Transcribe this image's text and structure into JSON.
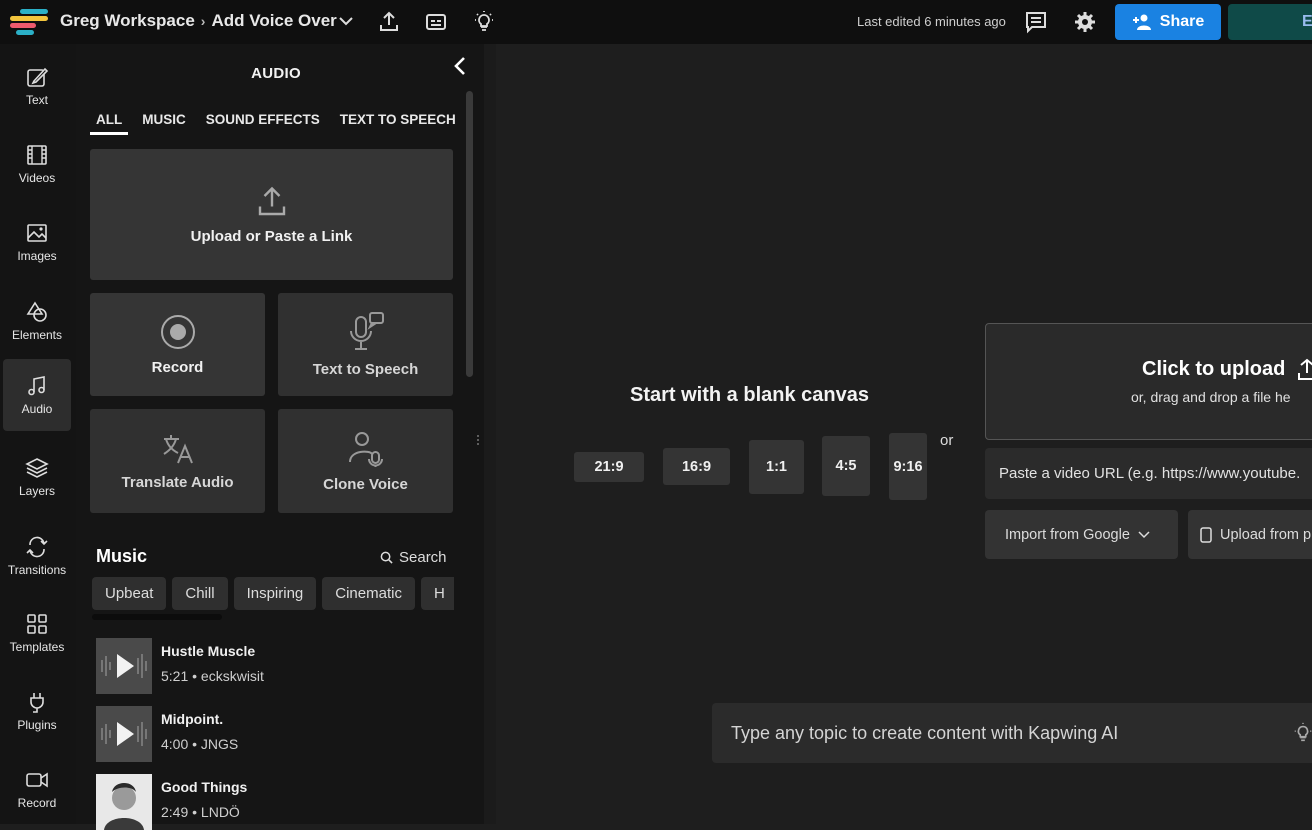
{
  "header": {
    "workspace": "Greg Workspace",
    "separator": "›",
    "project": "Add Voice Over",
    "last_edited": "Last edited 6 minutes ago",
    "share_label": "Share",
    "export_label": "E",
    "icons": [
      "upload-icon",
      "subtitles-icon",
      "lightbulb-icon",
      "comment-icon",
      "gear-icon"
    ]
  },
  "nav": {
    "items": [
      {
        "label": "Text",
        "icon": "text-icon"
      },
      {
        "label": "Videos",
        "icon": "film-icon"
      },
      {
        "label": "Images",
        "icon": "image-icon"
      },
      {
        "label": "Elements",
        "icon": "shapes-icon"
      },
      {
        "label": "Audio",
        "icon": "music-note-icon"
      },
      {
        "label": "Layers",
        "icon": "layers-icon"
      },
      {
        "label": "Transitions",
        "icon": "transitions-icon"
      },
      {
        "label": "Templates",
        "icon": "grid-icon"
      },
      {
        "label": "Plugins",
        "icon": "plug-icon"
      },
      {
        "label": "Record",
        "icon": "camera-icon"
      }
    ],
    "active": "Audio"
  },
  "panel": {
    "title": "AUDIO",
    "tabs": [
      "ALL",
      "MUSIC",
      "SOUND EFFECTS",
      "TEXT TO SPEECH"
    ],
    "active_tab": "ALL",
    "upload_label": "Upload or Paste a Link",
    "tiles": {
      "record": "Record",
      "tts": "Text to Speech",
      "translate": "Translate Audio",
      "clone": "Clone Voice"
    },
    "music_heading": "Music",
    "search_label": "Search",
    "chips": [
      "Upbeat",
      "Chill",
      "Inspiring",
      "Cinematic",
      "H"
    ],
    "tracks": [
      {
        "name": "Hustle Muscle",
        "meta": "5:21 • eckskwisit"
      },
      {
        "name": "Midpoint.",
        "meta": "4:00 • JNGS"
      },
      {
        "name": "Good Things",
        "meta": "2:49 • LNDÖ"
      }
    ]
  },
  "canvas": {
    "blank_title": "Start with a blank canvas",
    "ratios": [
      "21:9",
      "16:9",
      "1:1",
      "4:5",
      "9:16"
    ],
    "or_label": "or",
    "upload_title": "Click to upload",
    "upload_sub": "or, drag and drop a file he",
    "url_placeholder": "Paste a video URL (e.g. https://www.youtube.",
    "import_google": "Import from Google",
    "upload_from": "Upload from p",
    "ai_prompt": "Type any topic to create content with Kapwing AI"
  },
  "colors": {
    "accent": "#1a82e2",
    "export": "#0f4a48",
    "background": "#1e1e1e",
    "panel": "#151515"
  }
}
